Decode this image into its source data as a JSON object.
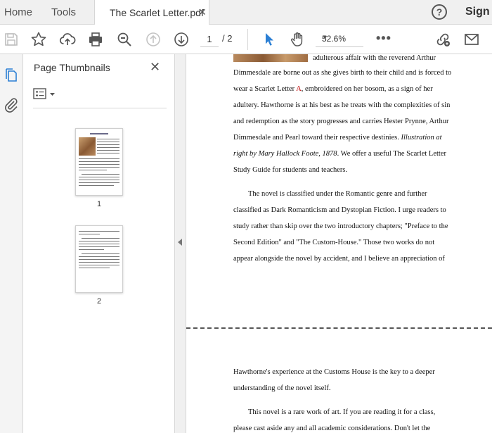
{
  "tabs": {
    "home": "Home",
    "tools": "Tools",
    "document": "The Scarlet Letter.pdf",
    "close": "✕"
  },
  "header": {
    "help": "?",
    "sign": "Sign"
  },
  "toolbar": {
    "current_page": "1",
    "total_pages": "/ 2",
    "zoom": "52.6%",
    "more": "•••"
  },
  "panel": {
    "title": "Page Thumbnails",
    "close": "✕",
    "thumbnails": [
      {
        "label": "1"
      },
      {
        "label": "2"
      }
    ]
  },
  "doc": {
    "page1": {
      "line1": "adulterous affair with the reverend Arthur",
      "line2": "Dimmesdale are borne out as she gives birth to their child and is forced to",
      "line3_a": "wear a Scarlet Letter ",
      "line3_red": "A",
      "line3_b": ", embroidered on her bosom, as a sign of her",
      "line4": "adultery. Hawthorne is at his best as he treats with the complexities of sin",
      "line5": "and redemption as the story progresses and carries Hester Prynne, Arthur",
      "line6_a": "Dimmesdale and Pearl toward their respective destinies. ",
      "line6_i": "Illustration at",
      "line7_i": "right by Mary Hallock Foote, 1878",
      "line7_b": ". We offer a useful The Scarlet Letter",
      "line8": "Study Guide for students and teachers.",
      "line9": "The novel is classified under the Romantic genre and further",
      "line10": "classified as Dark Romanticism and Dystopian Fiction. I urge readers to",
      "line11": "study rather than skip over the two introductory chapters; \"Preface to the",
      "line12": "Second Edition\" and \"The Custom-House.\" Those two works do not",
      "line13": "appear alongside the novel by accident, and I believe an appreciation of"
    },
    "page2": {
      "line1": "Hawthorne's experience at the Customs House is the key to a deeper",
      "line2": "understanding of the novel itself.",
      "line3": "This novel is a rare work of art. If you are reading it for a class,",
      "line4": "please cast aside any and all academic considerations. Don't let the"
    }
  },
  "colors": {
    "accent_blue": "#2b7fd4",
    "scarlet": "#c00000"
  }
}
